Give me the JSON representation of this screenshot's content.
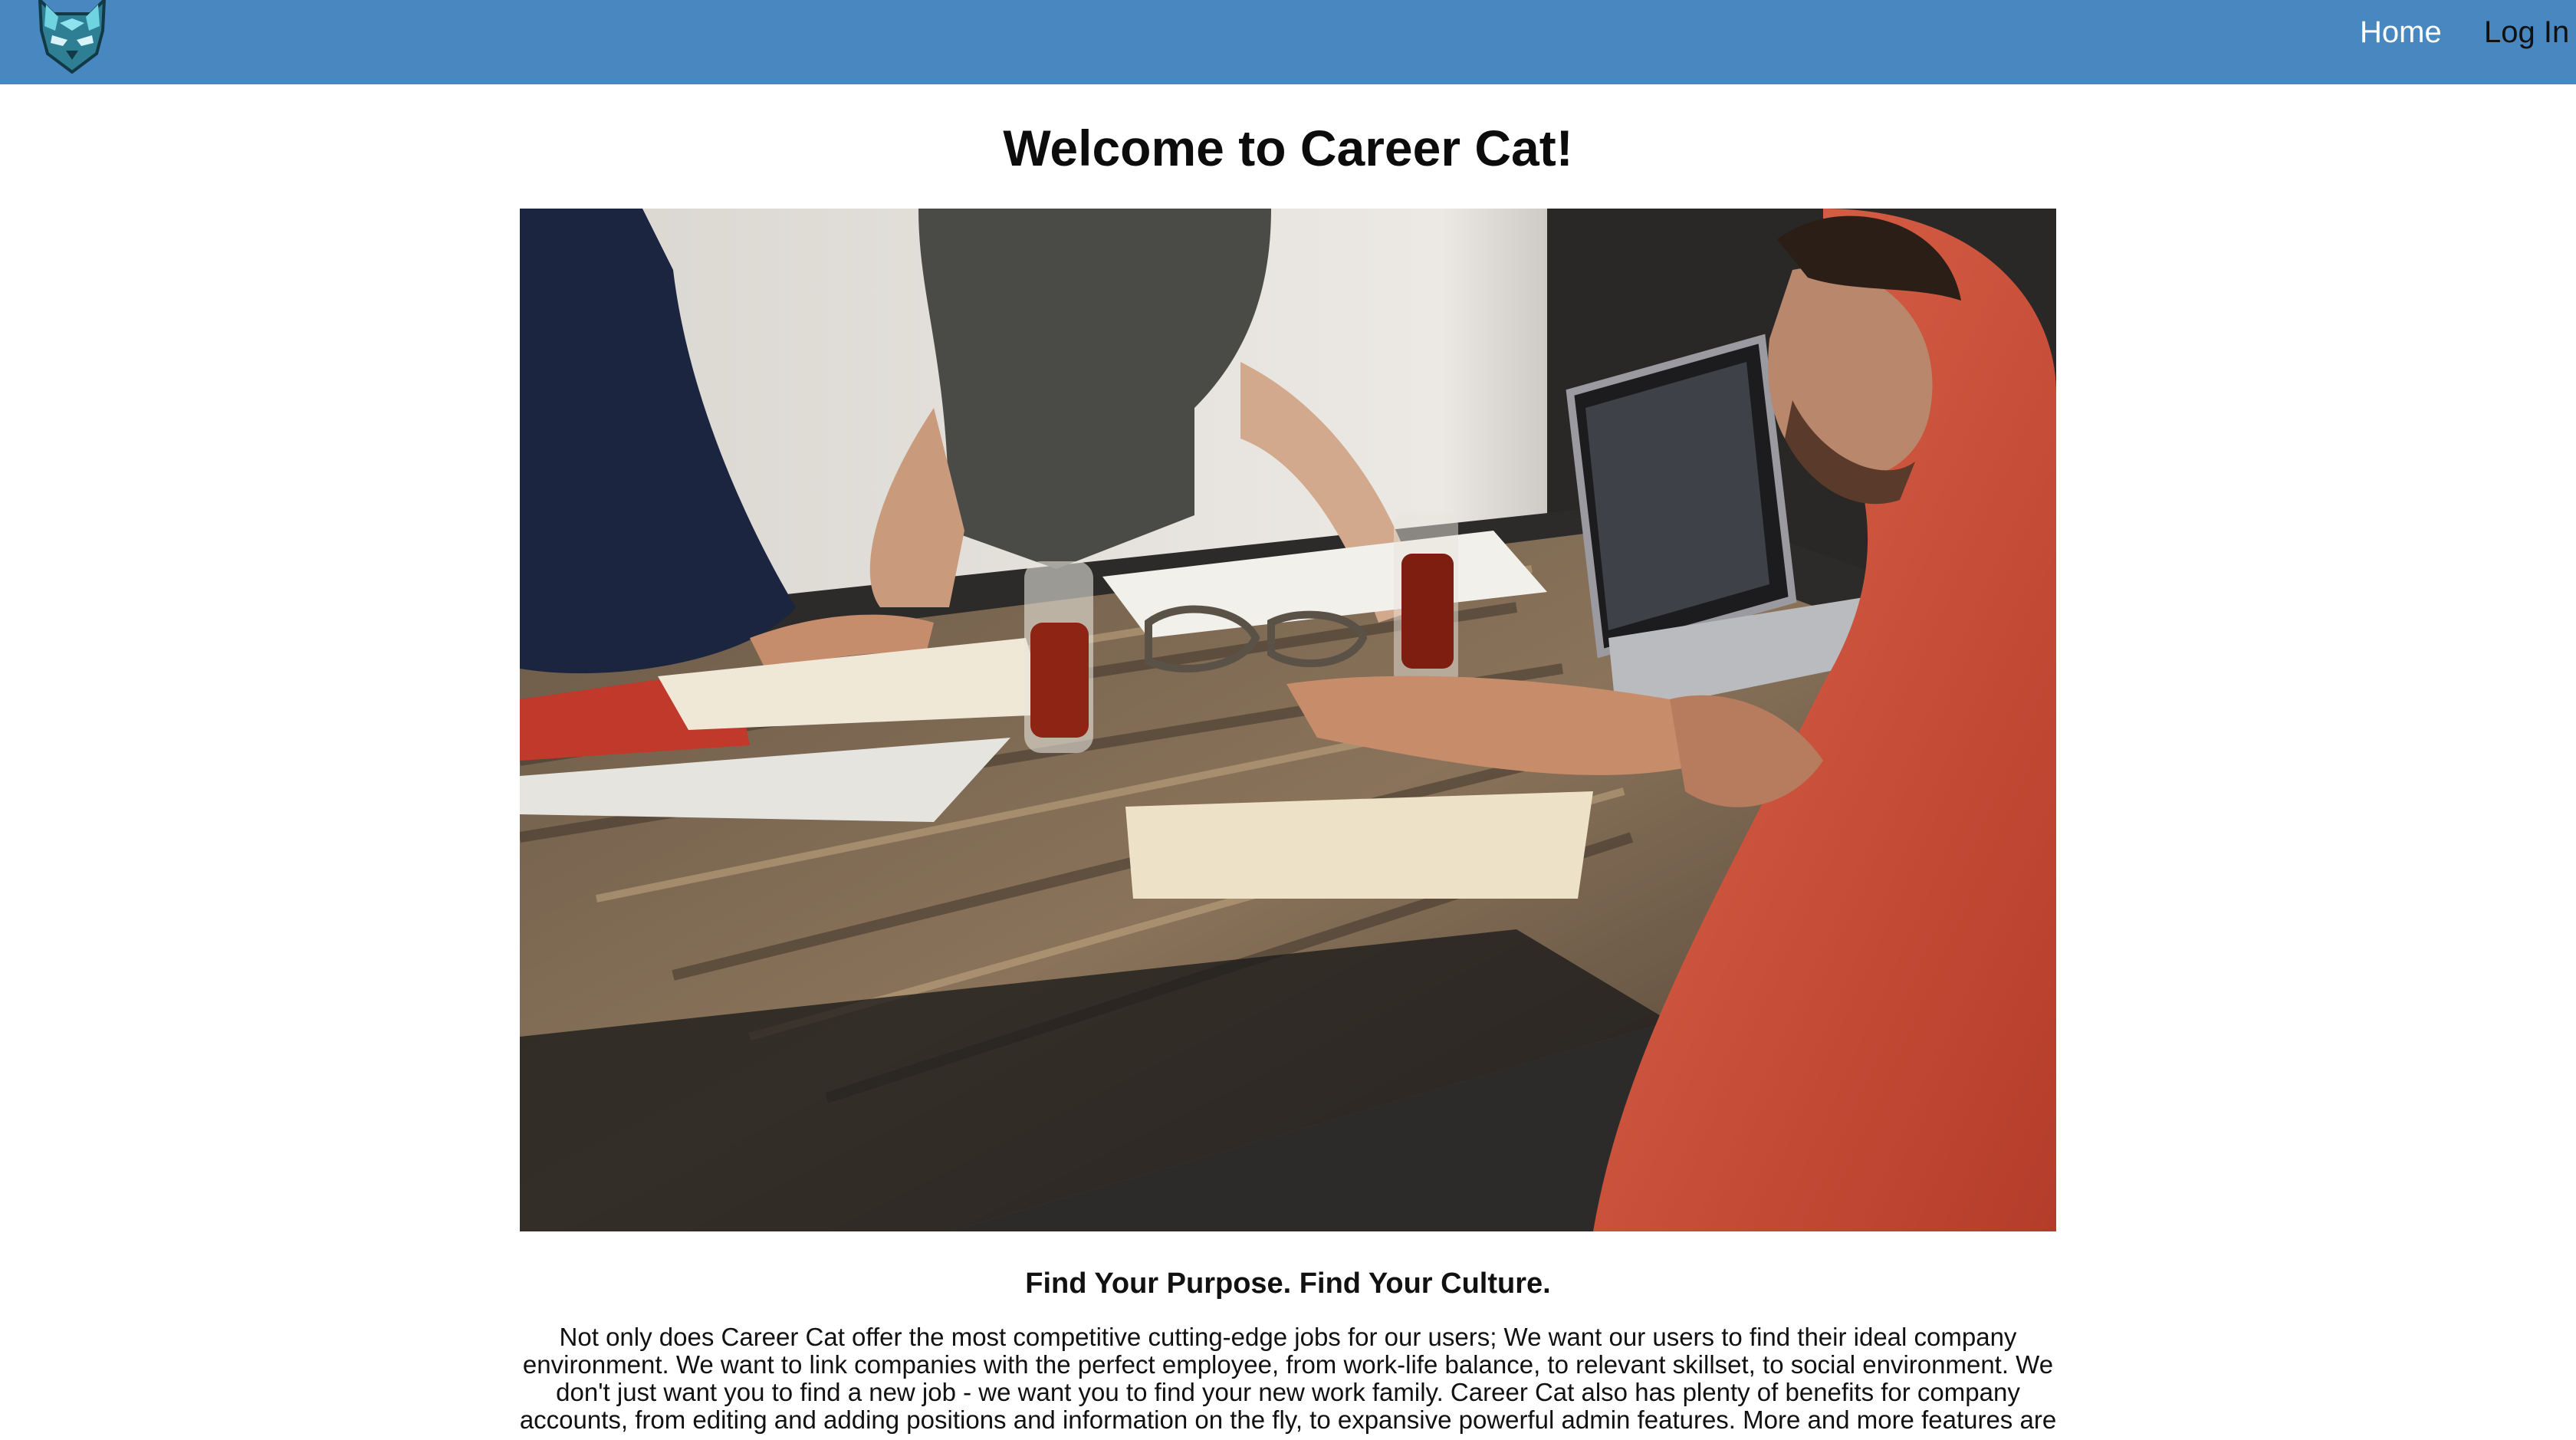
{
  "nav": {
    "logo_icon": "cat-head-logo-icon",
    "home_label": "Home",
    "login_label": "Log In",
    "bar_color": "#4887c0"
  },
  "main": {
    "title": "Welcome to Career Cat!",
    "hero_image": "photo of people working around a wooden table with laptops, notebooks and iced drinks",
    "subtitle": "Find Your Purpose. Find Your Culture.",
    "description": "Not only does Career Cat offer the most competitive cutting-edge jobs for our users; We want our users to find their ideal company environment. We want to link companies with the perfect employee, from work-life balance, to relevant skillset, to social environment. We don't just want you to find a new job - we want you to find your new work family. Career Cat also has plenty of benefits for company accounts, from editing and adding positions and information on the fly, to expansive powerful admin features. More and more features are"
  }
}
